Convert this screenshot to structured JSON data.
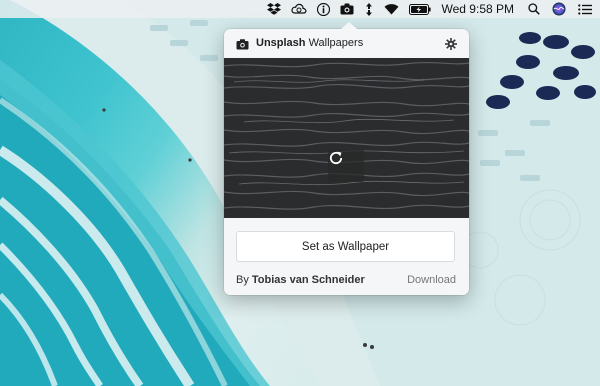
{
  "menubar": {
    "icons": [
      "dropbox-icon",
      "creative-cloud-icon",
      "info-icon",
      "camera-icon",
      "network-arrows-icon",
      "wifi-icon",
      "battery-icon"
    ],
    "clock": "Wed 9:58 PM",
    "right_icons": [
      "spotlight-search-icon",
      "siri-icon",
      "notification-center-icon"
    ]
  },
  "popover": {
    "brand": "Unsplash",
    "title_rest": "Wallpapers",
    "set_button_label": "Set as Wallpaper",
    "credit_prefix": "By",
    "credit_name": "Tobias van Schneider",
    "download_label": "Download"
  }
}
